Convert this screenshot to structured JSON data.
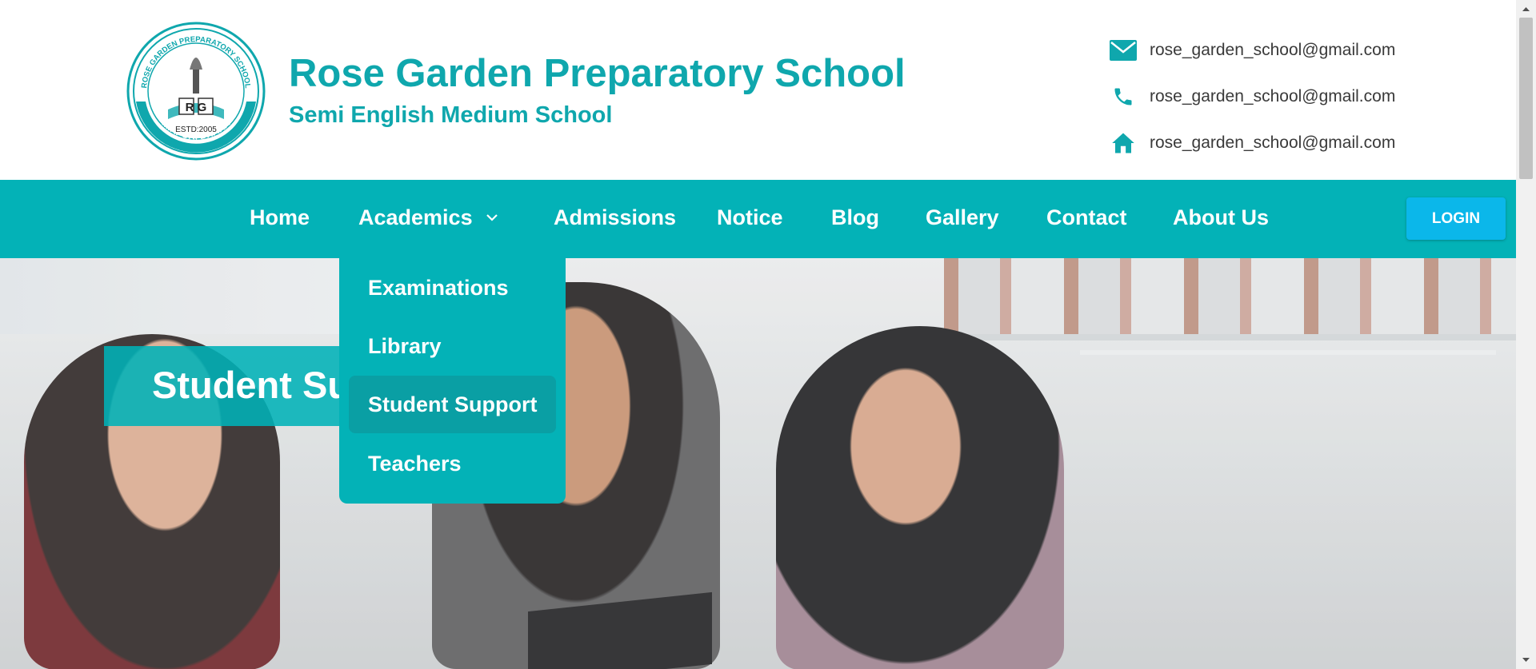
{
  "header": {
    "logo": {
      "ring_text": "ROSE GARDEN PREPARATORY SCHOOL",
      "initials": "R G",
      "estd": "ESTD:2005",
      "location": "MIRPUR, DHAKA"
    },
    "title": "Rose Garden Preparatory School",
    "subtitle": "Semi English Medium School",
    "contacts": [
      {
        "icon": "mail-icon",
        "text": "rose_garden_school@gmail.com"
      },
      {
        "icon": "phone-icon",
        "text": "rose_garden_school@gmail.com"
      },
      {
        "icon": "home-icon",
        "text": "rose_garden_school@gmail.com"
      }
    ]
  },
  "nav": {
    "items": [
      "Home",
      "Academics",
      "Admissions",
      "Notice",
      "Blog",
      "Gallery",
      "Contact",
      "About Us"
    ],
    "login_label": "LOGIN",
    "dropdown": {
      "parent": "Academics",
      "items": [
        "Examinations",
        "Library",
        "Student Support",
        "Teachers"
      ],
      "active": "Student Support"
    }
  },
  "hero": {
    "title": "Student Support"
  },
  "colors": {
    "primary": "#03b2b7",
    "title_teal": "#0fa7ad",
    "login_blue": "#0bb7ea",
    "dropdown_active": "#0a9fa4"
  }
}
